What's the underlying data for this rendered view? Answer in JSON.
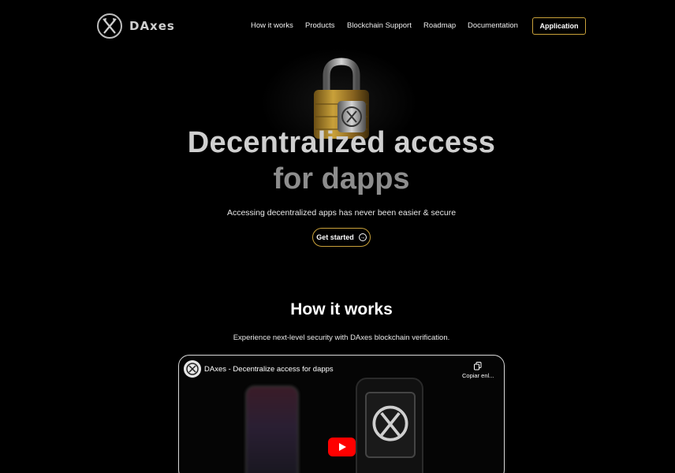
{
  "brand": {
    "name": "DAxes",
    "logo_icon": "crossed-axes-icon"
  },
  "nav": {
    "items": [
      {
        "label": "How it works"
      },
      {
        "label": "Products"
      },
      {
        "label": "Blockchain Support"
      },
      {
        "label": "Roadmap"
      },
      {
        "label": "Documentation"
      }
    ],
    "cta": "Application"
  },
  "hero": {
    "title_line1": "Decentralized access",
    "title_line2": "for dapps",
    "subtitle": "Accessing decentralized apps has never been easier & secure",
    "button": "Get started",
    "button_icon": "arrow-right-circle-icon",
    "image_icon": "padlock-icon"
  },
  "how_it_works": {
    "title": "How it works",
    "subtitle": "Experience next-level security with DAxes blockchain verification."
  },
  "video": {
    "title": "DAxes - Decentralize access for dapps",
    "copy_label": "Copiar enl...",
    "play_icon": "youtube-play-icon"
  },
  "colors": {
    "accent": "#c9a13a",
    "background": "#000000"
  }
}
